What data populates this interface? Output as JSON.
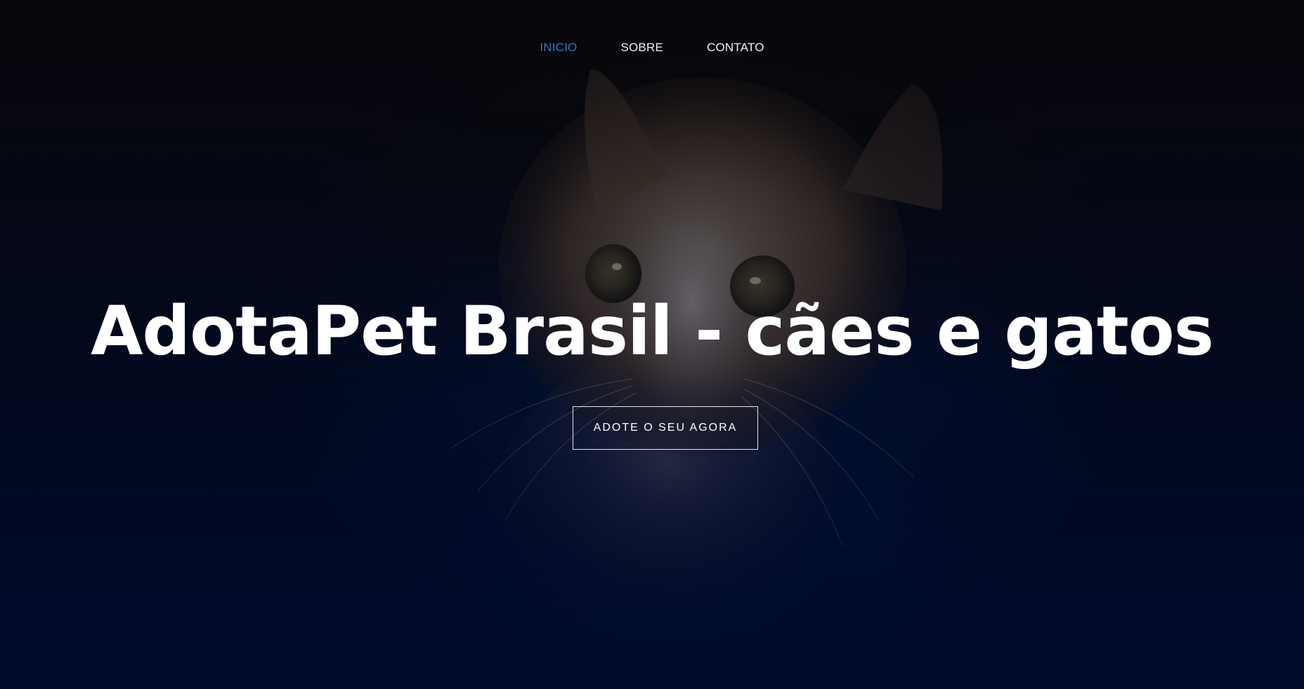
{
  "nav": {
    "items": [
      {
        "label": "INICIO",
        "active": true
      },
      {
        "label": "SOBRE",
        "active": false
      },
      {
        "label": "CONTATO",
        "active": false
      }
    ]
  },
  "hero": {
    "title": "AdotaPet Brasil - cães e gatos",
    "cta_label": "ADOTE O SEU AGORA",
    "background_image": "cat-photo"
  },
  "colors": {
    "nav_active": "#2f79c8",
    "nav_text": "#f2f2f2",
    "title_text": "#ffffff",
    "background_top": "#0a0908",
    "background_bottom": "#01123e"
  }
}
